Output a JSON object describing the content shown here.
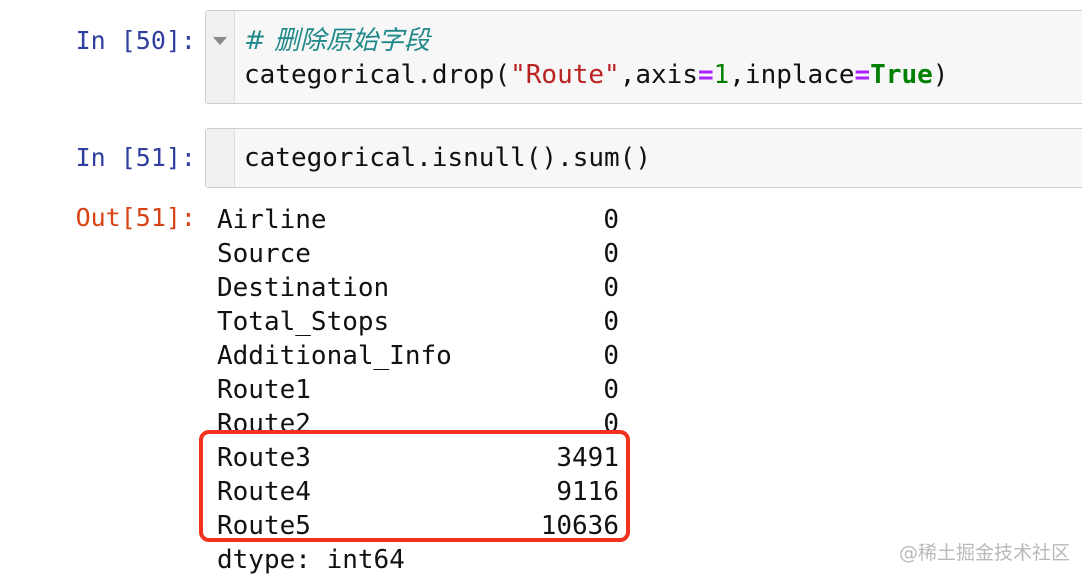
{
  "cells": [
    {
      "prompt": "In [50]:",
      "comment": "# 删除原始字段",
      "code": {
        "p1": "categorical.drop(",
        "str": "\"Route\"",
        "p2": ",axis",
        "eq1": "=",
        "num": "1",
        "p3": ",inplace",
        "eq2": "=",
        "kw": "True",
        "p4": ")"
      }
    },
    {
      "prompt": "In [51]:",
      "code_line": "categorical.isnull().sum()"
    }
  ],
  "output": {
    "prompt": "Out[51]:",
    "rows": [
      {
        "name": "Airline",
        "value": "0"
      },
      {
        "name": "Source",
        "value": "0"
      },
      {
        "name": "Destination",
        "value": "0"
      },
      {
        "name": "Total_Stops",
        "value": "0"
      },
      {
        "name": "Additional_Info",
        "value": "0"
      },
      {
        "name": "Route1",
        "value": "0"
      },
      {
        "name": "Route2",
        "value": "0"
      },
      {
        "name": "Route3",
        "value": "3491"
      },
      {
        "name": "Route4",
        "value": "9116"
      },
      {
        "name": "Route5",
        "value": "10636"
      }
    ],
    "dtype": "dtype: int64"
  },
  "highlight_color": "#f2311f",
  "watermark": "@稀土掘金技术社区"
}
